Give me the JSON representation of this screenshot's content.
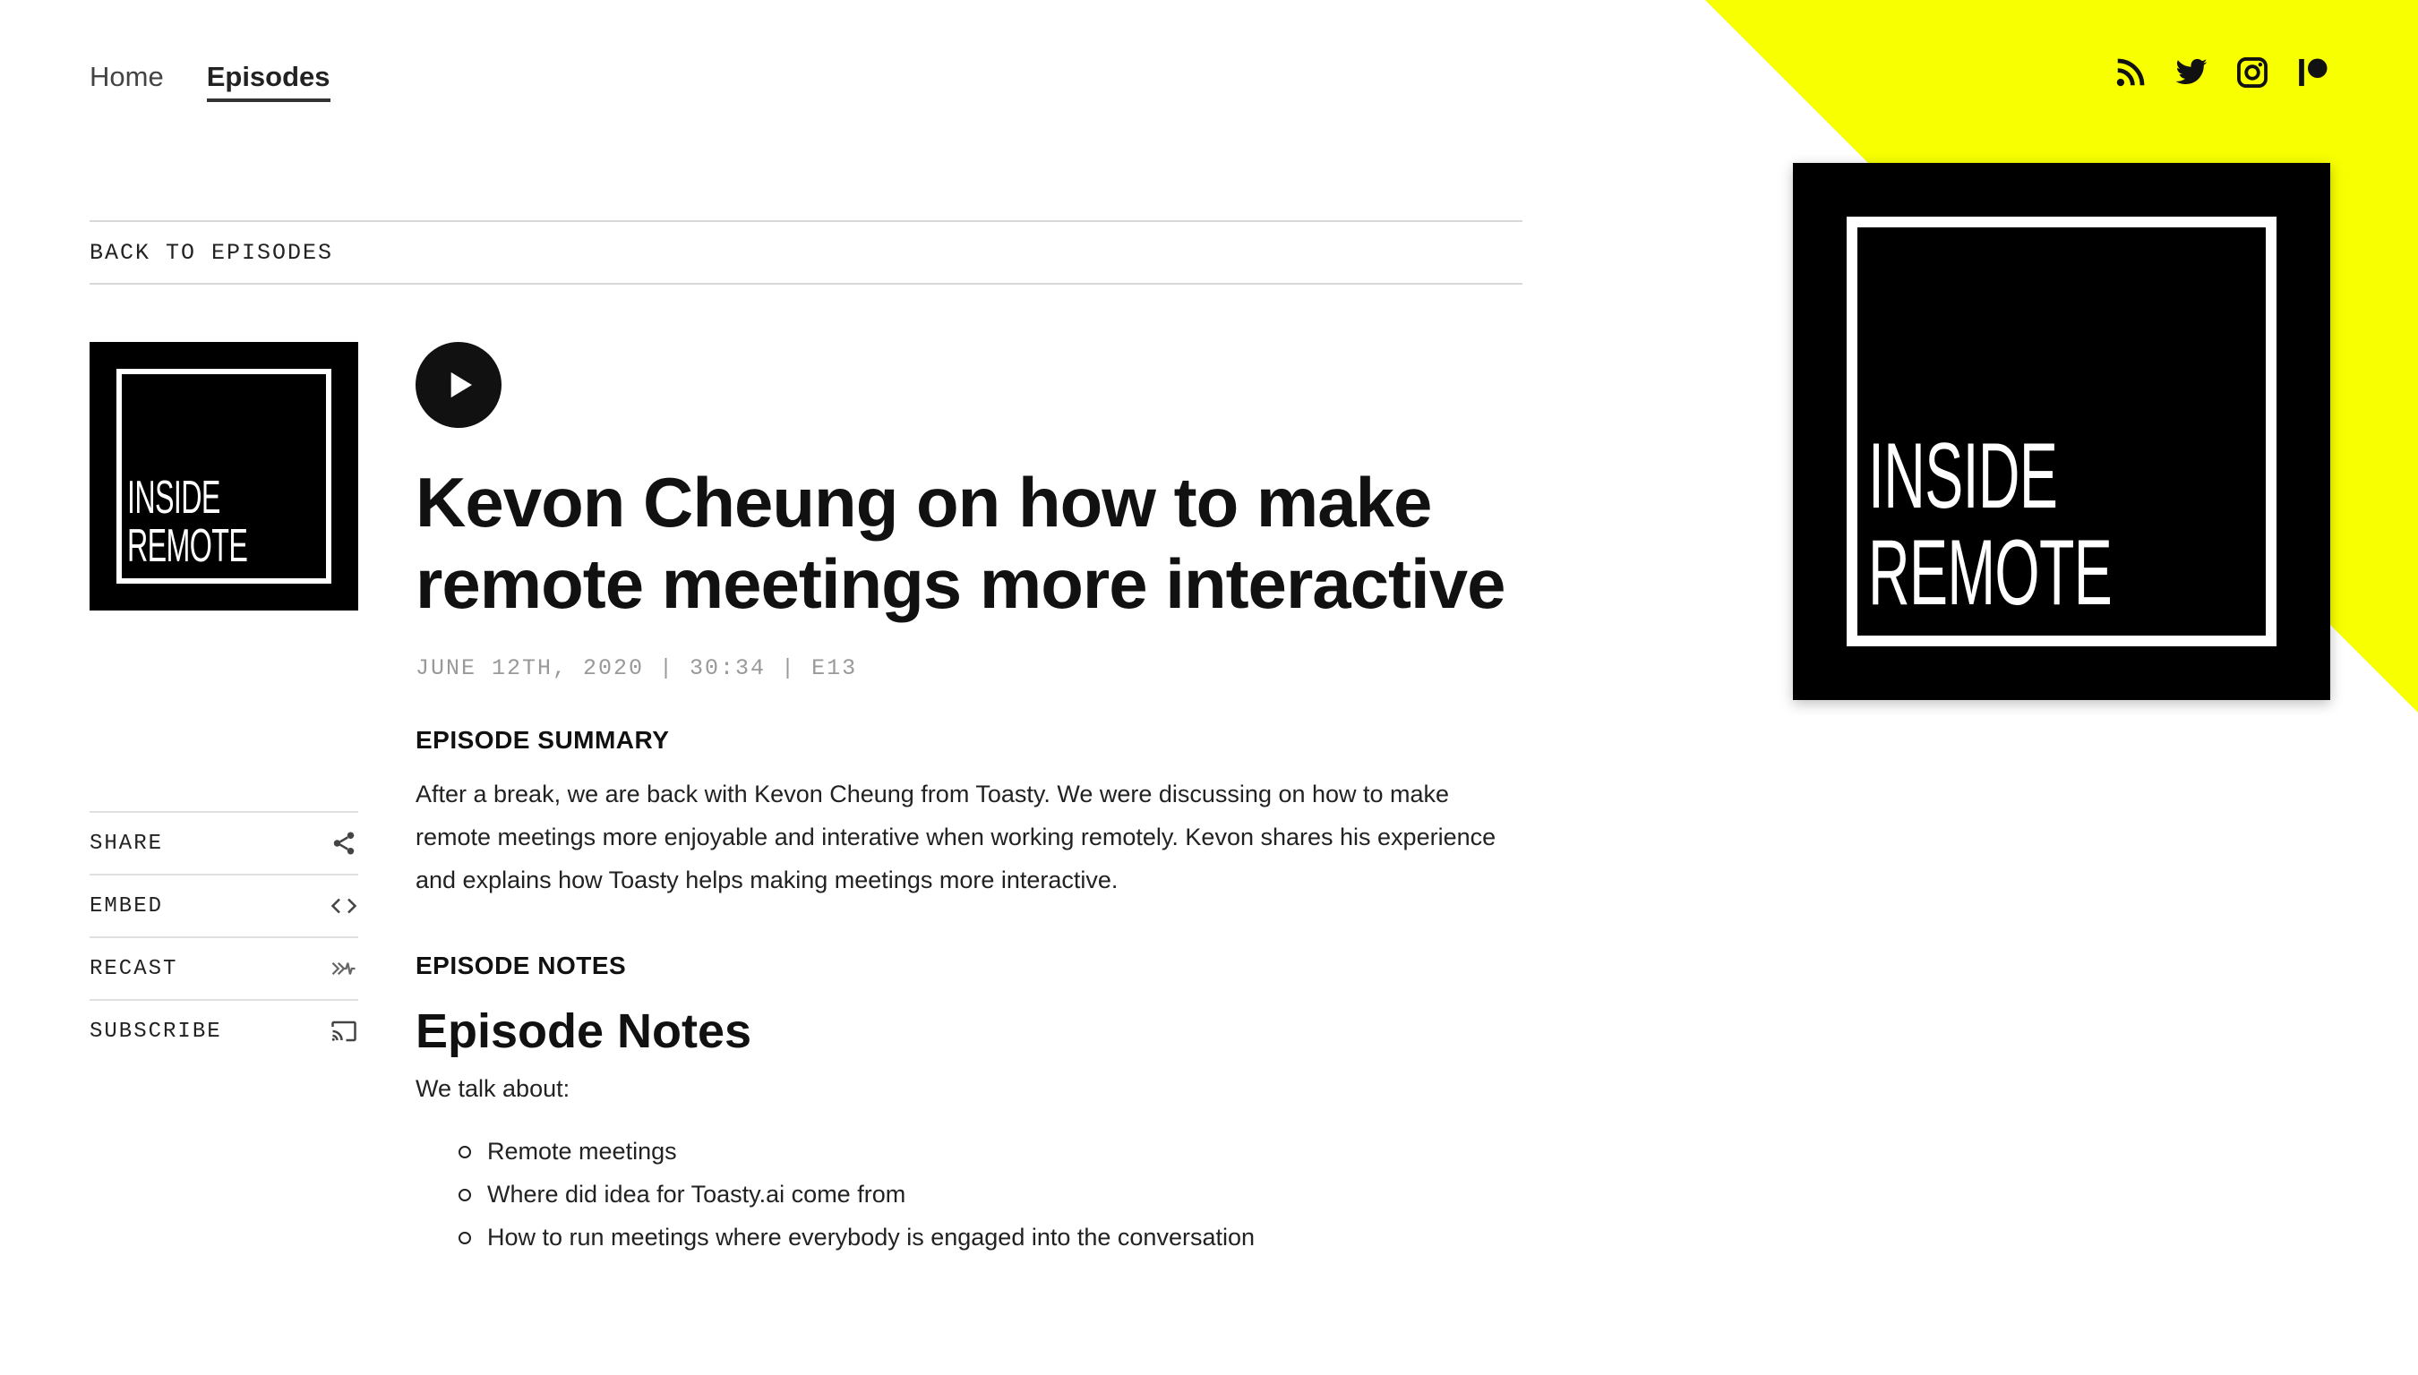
{
  "nav": {
    "home_label": "Home",
    "episodes_label": "Episodes"
  },
  "social": {
    "icons": [
      "rss-icon",
      "twitter-icon",
      "instagram-icon",
      "patreon-icon"
    ]
  },
  "back_link": "BACK TO EPISODES",
  "cover": {
    "line1": "INSIDE",
    "line2": "REMOTE"
  },
  "episode": {
    "title": "Kevon Cheung on how to make remote meetings more interactive",
    "meta": "JUNE 12TH, 2020 | 30:34 | E13",
    "summary_heading": "EPISODE SUMMARY",
    "summary": "After a break, we are back with Kevon Cheung from Toasty. We were discussing on how to make remote meetings more enjoyable and interative when working remotely. Kevon shares his experience and explains how Toasty helps making meetings more interactive.",
    "notes_heading": "EPISODE NOTES",
    "notes_title": "Episode Notes",
    "notes_intro": "We talk about:",
    "notes_items": [
      "Remote meetings",
      "Where did idea for Toasty.ai come from",
      "How to run meetings where everybody is engaged into the conversation"
    ]
  },
  "actions": {
    "share": "SHARE",
    "embed": "EMBED",
    "recast": "RECAST",
    "subscribe": "SUBSCRIBE"
  },
  "colors": {
    "accent": "#f8ff00",
    "text": "#111111",
    "muted": "#999999"
  }
}
